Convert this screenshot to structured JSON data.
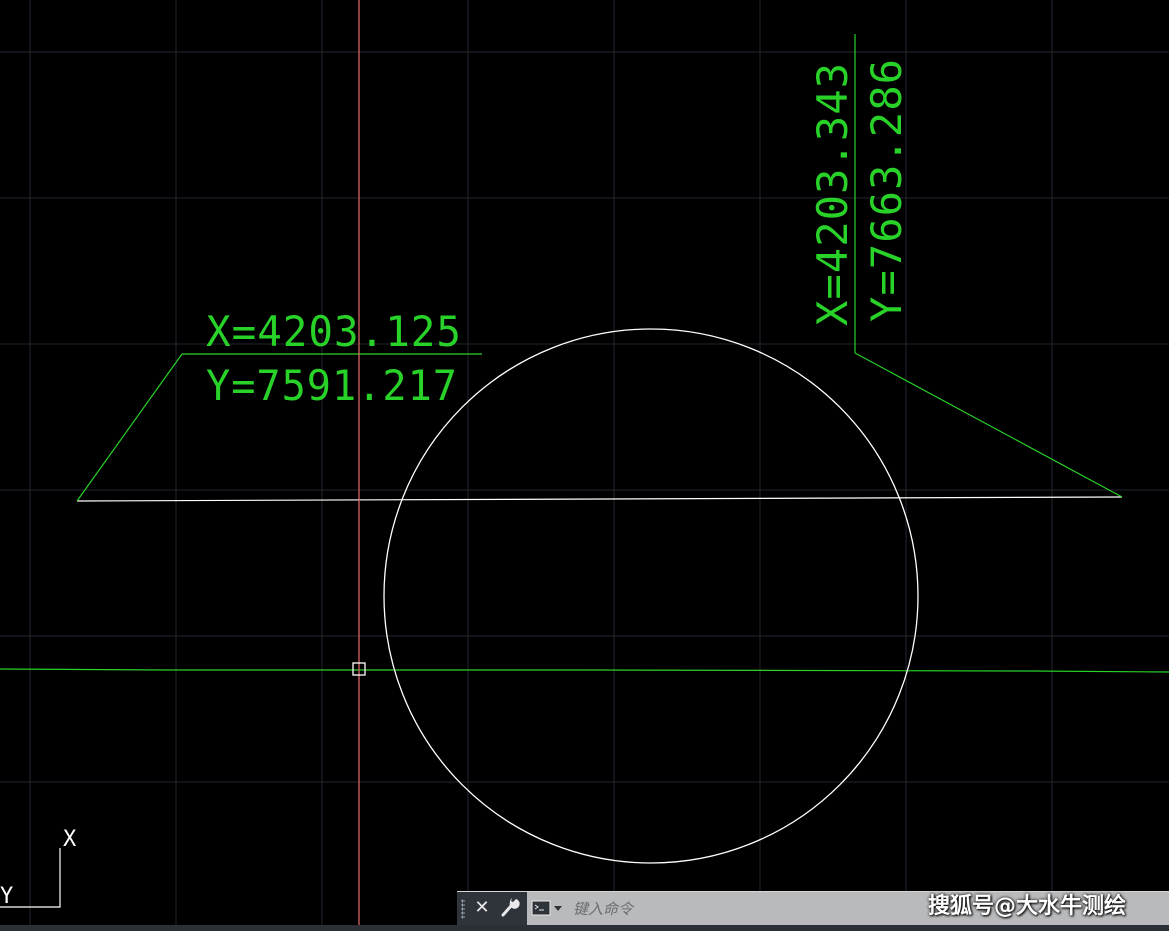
{
  "drawing": {
    "label_left_x": "X=4203.125",
    "label_left_y": "Y=7591.217",
    "label_right_x": "X=4203.343",
    "label_right_y": "Y=7663.286",
    "ucs_x": "X",
    "ucs_y": "Y",
    "colors": {
      "background": "#000000",
      "grid": "#23262f",
      "annotation": "#28d228",
      "geometry": "#ffffff",
      "crosshair": "#e86a6a"
    }
  },
  "command_line": {
    "placeholder": "键入命令",
    "close_icon": "close-icon",
    "customize_icon": "wrench-icon",
    "recent_icon": "command-prompt-icon"
  },
  "watermark": {
    "text": "搜狐号@大水牛测绘"
  }
}
